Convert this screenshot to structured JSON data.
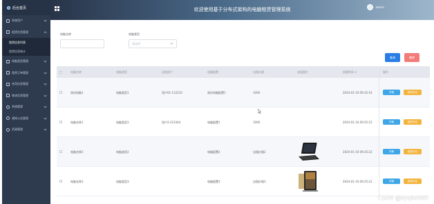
{
  "sidebar": {
    "logo": "后台首页",
    "items": [
      {
        "label": "系统用户"
      },
      {
        "label": "租赁信息管理",
        "open": true,
        "children": [
          {
            "label": "租赁信息列表",
            "active": true
          },
          {
            "label": "租赁信息统计"
          }
        ]
      },
      {
        "label": "电脑类型管理"
      },
      {
        "label": "租赁订单管理"
      },
      {
        "label": "合同信息管理"
      },
      {
        "label": "物流信息管理"
      },
      {
        "label": "系统管理"
      },
      {
        "label": "通知公告管理"
      },
      {
        "label": "资源管理"
      }
    ]
  },
  "topbar": {
    "title": "欢迎使用基于分布式架构的电脑租赁管理系统",
    "username": "admin"
  },
  "filters": {
    "name_label": "电脑名称",
    "type_label": "电脑类型",
    "type_placeholder": "请选择"
  },
  "toolbar": {
    "search_label": "查询",
    "delete_label": "删除"
  },
  "table": {
    "columns": [
      "电脑名称",
      "电脑类型",
      "出租用户",
      "电脑配置",
      "出租价格",
      "封面图片",
      "创建时间 ↕",
      "操作"
    ],
    "rows": [
      {
        "name": "测试电脑1",
        "type": "电脑类型1",
        "user": "用户01-112233",
        "config": "测试电脑配置1",
        "price": "1000",
        "cover": "",
        "created": "2024-01-10 09:32:43"
      },
      {
        "name": "电脑名称1",
        "type": "电脑类型1",
        "user": "用户2-223344",
        "config": "电脑配置1",
        "price": "1000",
        "cover": "",
        "created": "2024-01-10 09:25:22"
      },
      {
        "name": "电脑名称2",
        "type": "电脑类型2",
        "user": "",
        "config": "电脑配置2",
        "price": "出租价格2",
        "cover": "laptop",
        "created": "2024-01-10 09:25:22"
      },
      {
        "name": "电脑名称3",
        "type": "电脑类型3",
        "user": "",
        "config": "电脑配置3",
        "price": "出租价格3",
        "cover": "tablet",
        "created": "2024-01-10 09:25:22"
      }
    ],
    "detail_label": "详情",
    "rent_label": "租赁评论"
  },
  "watermark": "CSDN @bysjlw985",
  "colors": {
    "sidebar": "#2e3a4e",
    "search": "#2b7de6",
    "delete": "#f27b78",
    "detail": "#3fa7e8",
    "rent": "#f3b43d"
  }
}
